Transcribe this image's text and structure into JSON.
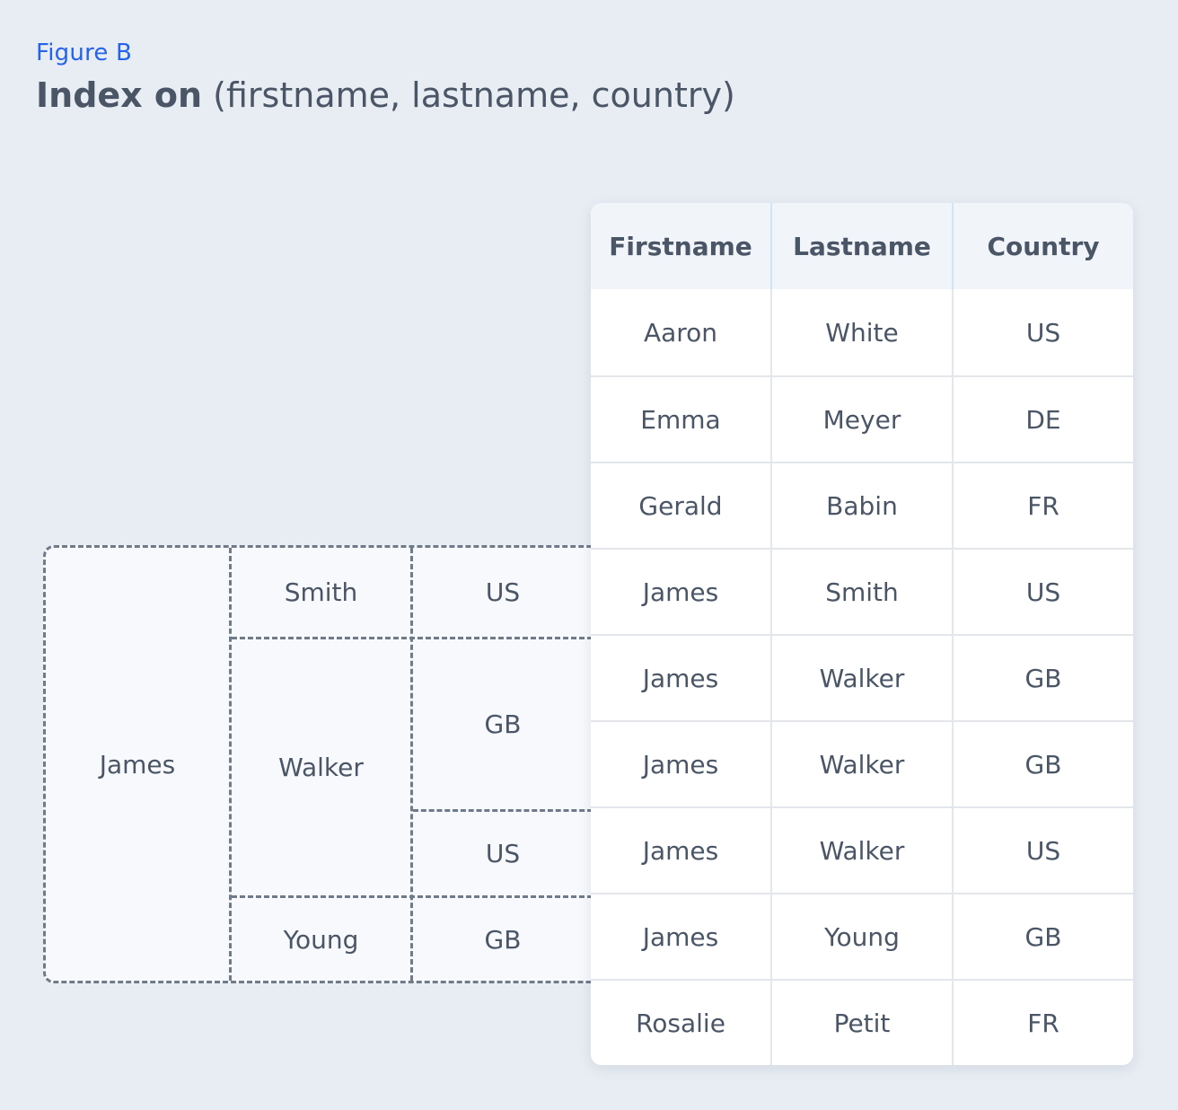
{
  "figure_label": "Figure B",
  "title": {
    "strong": "Index on",
    "rest": "(firstname, lastname, country)"
  },
  "index_tree": {
    "firstname": "James",
    "lastnames": [
      {
        "name": "Smith",
        "countries": [
          "US"
        ]
      },
      {
        "name": "Walker",
        "countries": [
          "GB",
          "US"
        ]
      },
      {
        "name": "Young",
        "countries": [
          "GB"
        ]
      }
    ]
  },
  "table": {
    "headers": [
      "Firstname",
      "Lastname",
      "Country"
    ],
    "rows": [
      [
        "Aaron",
        "White",
        "US"
      ],
      [
        "Emma",
        "Meyer",
        "DE"
      ],
      [
        "Gerald",
        "Babin",
        "FR"
      ],
      [
        "James",
        "Smith",
        "US"
      ],
      [
        "James",
        "Walker",
        "GB"
      ],
      [
        "James",
        "Walker",
        "GB"
      ],
      [
        "James",
        "Walker",
        "US"
      ],
      [
        "James",
        "Young",
        "GB"
      ],
      [
        "Rosalie",
        "Petit",
        "FR"
      ]
    ]
  }
}
